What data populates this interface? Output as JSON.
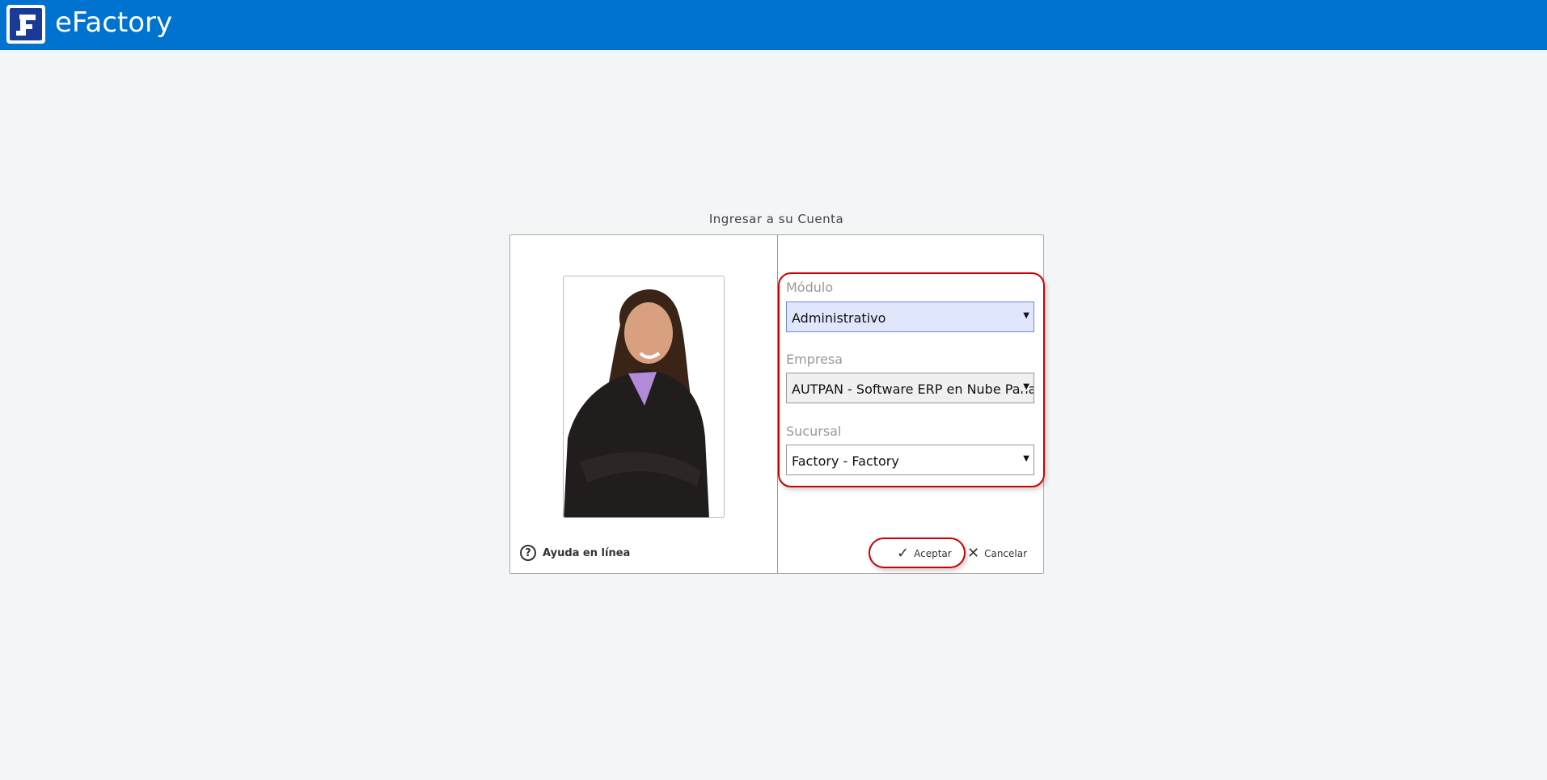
{
  "header": {
    "app_name": "eFactory",
    "logo_icon": "efactory-logo",
    "color": "#0073d1"
  },
  "login": {
    "title": "Ingresar a su Cuenta",
    "help_label": "Ayuda en línea",
    "fields": [
      {
        "label": "Módulo",
        "value": "Administrativo"
      },
      {
        "label": "Empresa",
        "value": "AUTPAN - Software ERP en Nube Panamá"
      },
      {
        "label": "Sucursal",
        "value": "Factory - Factory"
      }
    ],
    "accept_label": "Aceptar",
    "cancel_label": "Cancelar",
    "highlight_color": "#cc0000"
  }
}
